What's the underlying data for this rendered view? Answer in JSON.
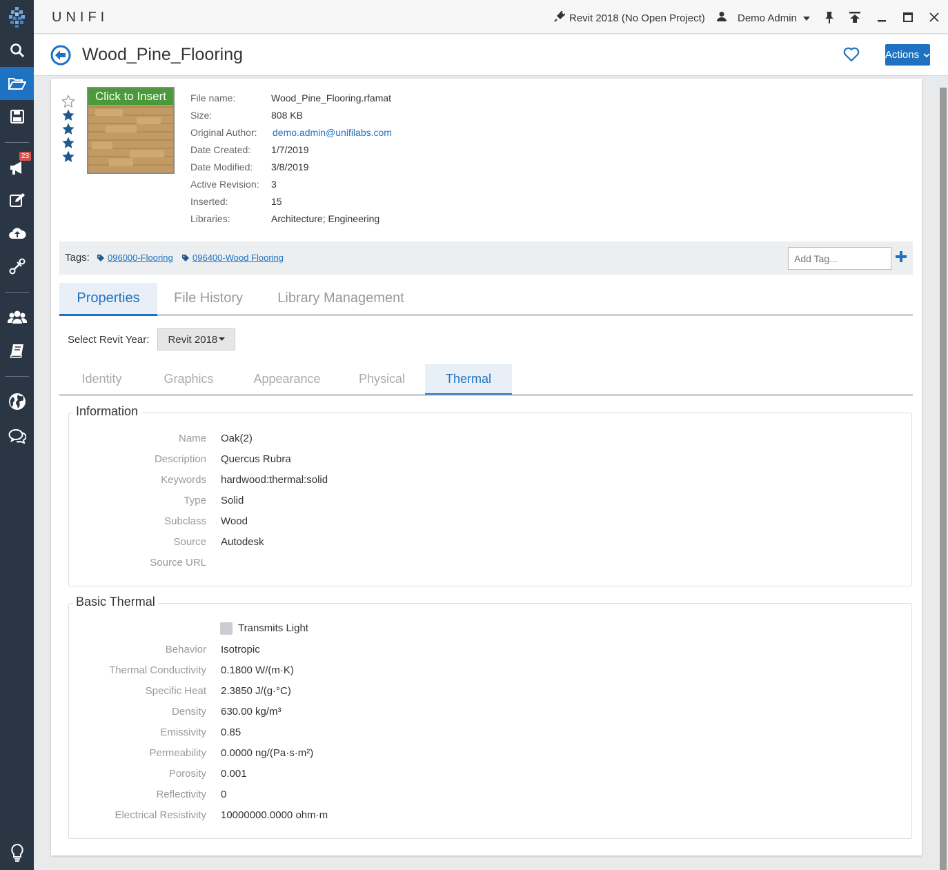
{
  "app": {
    "brand": "UNIFI"
  },
  "titlebar": {
    "revit_status": "Revit 2018 (No Open Project)",
    "user_name": "Demo Admin"
  },
  "sidebar": {
    "notification_count": "23"
  },
  "header": {
    "title": "Wood_Pine_Flooring",
    "actions_label": "Actions"
  },
  "file": {
    "rating": {
      "filled": 4,
      "max": 5
    },
    "thumbnail_label": "Click to Insert",
    "details": [
      {
        "key": "File name:",
        "value": "Wood_Pine_Flooring.rfamat"
      },
      {
        "key": "Size:",
        "value": "808 KB"
      },
      {
        "key": "Original Author:",
        "value": "demo.admin@unifilabs.com"
      },
      {
        "key": "Date Created:",
        "value": "1/7/2019"
      },
      {
        "key": "Date Modified:",
        "value": "3/8/2019"
      },
      {
        "key": "Active Revision:",
        "value": "3"
      },
      {
        "key": "Inserted:",
        "value": "15"
      },
      {
        "key": "Libraries:",
        "value": "Architecture; Engineering"
      }
    ]
  },
  "tags": {
    "label": "Tags:",
    "items": [
      "096000-Flooring",
      "096400-Wood Flooring"
    ],
    "add_placeholder": "Add Tag..."
  },
  "main_tabs": [
    "Properties",
    "File History",
    "Library Management"
  ],
  "revit_year": {
    "label": "Select Revit Year:",
    "selected": "Revit 2018"
  },
  "sub_tabs": [
    "Identity",
    "Graphics",
    "Appearance",
    "Physical",
    "Thermal"
  ],
  "information": {
    "title": "Information",
    "rows": [
      {
        "label": "Name",
        "value": "Oak(2)"
      },
      {
        "label": "Description",
        "value": "Quercus Rubra"
      },
      {
        "label": "Keywords",
        "value": "hardwood:thermal:solid"
      },
      {
        "label": "Type",
        "value": "Solid"
      },
      {
        "label": "Subclass",
        "value": "Wood"
      },
      {
        "label": "Source",
        "value": "Autodesk"
      },
      {
        "label": "Source URL",
        "value": ""
      }
    ]
  },
  "basic_thermal": {
    "title": "Basic Thermal",
    "transmits_light_label": "Transmits Light",
    "rows": [
      {
        "label": "Behavior",
        "value": "Isotropic"
      },
      {
        "label": "Thermal Conductivity",
        "value": "0.1800 W/(m·K)"
      },
      {
        "label": "Specific Heat",
        "value": "2.3850 J/(g·°C)"
      },
      {
        "label": "Density",
        "value": "630.00 kg/m³"
      },
      {
        "label": "Emissivity",
        "value": "0.85"
      },
      {
        "label": "Permeability",
        "value": "0.0000 ng/(Pa·s·m²)"
      },
      {
        "label": "Porosity",
        "value": "0.001"
      },
      {
        "label": "Reflectivity",
        "value": "0"
      },
      {
        "label": "Electrical Resistivity",
        "value": "10000000.0000 ohm·m"
      }
    ]
  },
  "colors": {
    "accent": "#1f72c1",
    "sidebar": "#2b3645",
    "badge": "#d9534f"
  }
}
